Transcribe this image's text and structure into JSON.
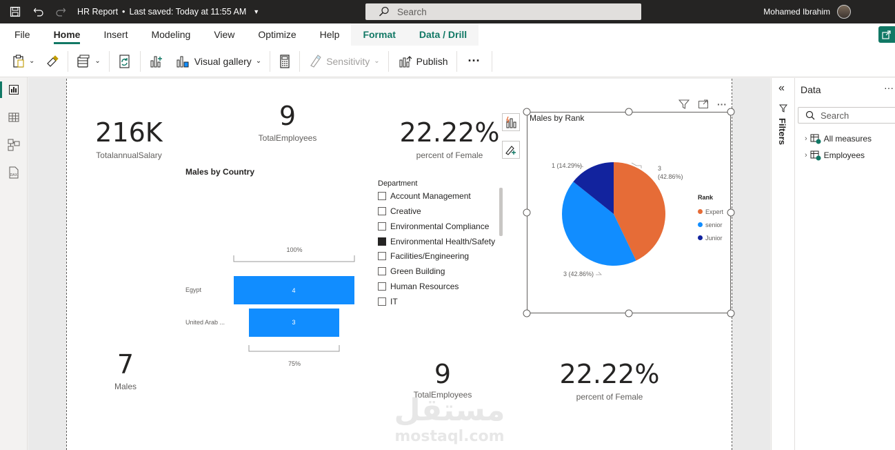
{
  "titlebar": {
    "title": "HR Report",
    "saved": "Last saved: Today at 11:55 AM",
    "search_placeholder": "Search",
    "user_name": "Mohamed Ibrahim"
  },
  "tabs": [
    {
      "label": "File"
    },
    {
      "label": "Home"
    },
    {
      "label": "Insert"
    },
    {
      "label": "Modeling"
    },
    {
      "label": "View"
    },
    {
      "label": "Optimize"
    },
    {
      "label": "Help"
    },
    {
      "label": "Format"
    },
    {
      "label": "Data / Drill"
    }
  ],
  "toolbar": {
    "visual_gallery": "Visual gallery",
    "sensitivity": "Sensitivity",
    "publish": "Publish",
    "more": "···"
  },
  "cards": {
    "salary_value": "216K",
    "salary_label": "TotalannualSalary",
    "total_value": "9",
    "total_label": "TotalEmployees",
    "female_value": "22.22%",
    "female_label": "percent of Female",
    "males_value": "7",
    "males_label": "Males",
    "total2_value": "9",
    "total2_label": "TotalEmployees",
    "female2_value": "22.22%",
    "female2_label": "percent of Female"
  },
  "funnel": {
    "title": "Males by Country",
    "top_pct": "100%",
    "bottom_pct": "75%",
    "rows": [
      {
        "label": "Egypt",
        "value": "4"
      },
      {
        "label": "United Arab ...",
        "value": "3"
      }
    ]
  },
  "slicer": {
    "title": "Department",
    "items": [
      {
        "label": "Account Management",
        "checked": false
      },
      {
        "label": "Creative",
        "checked": false
      },
      {
        "label": "Environmental Compliance",
        "checked": false
      },
      {
        "label": "Environmental Health/Safety",
        "checked": true
      },
      {
        "label": "Facilities/Engineering",
        "checked": false
      },
      {
        "label": "Green Building",
        "checked": false
      },
      {
        "label": "Human Resources",
        "checked": false
      },
      {
        "label": "IT",
        "checked": false
      }
    ]
  },
  "pie": {
    "title": "Males by Rank",
    "legend_title": "Rank",
    "labels": [
      "3",
      "(42.86%)",
      "3 (42.86%)",
      "1 (14.29%)"
    ]
  },
  "chart_data": [
    {
      "type": "bar",
      "title": "Males by Country",
      "categories": [
        "Egypt",
        "United Arab ..."
      ],
      "values": [
        4,
        3
      ]
    },
    {
      "type": "pie",
      "title": "Males by Rank",
      "categories": [
        "Expert",
        "senior",
        "Junior"
      ],
      "values": [
        3,
        3,
        1
      ],
      "percentages": [
        42.86,
        42.86,
        14.29
      ],
      "colors": [
        "#e66c37",
        "#118dff",
        "#12239e"
      ],
      "legend": "right"
    }
  ],
  "data_pane": {
    "title": "Data",
    "search_placeholder": "Search",
    "items": [
      "All measures",
      "Employees"
    ]
  },
  "filters_label": "Filters",
  "watermark": {
    "arabic": "مستقل",
    "latin": "mostaql.com"
  },
  "colors": {
    "accent": "#117865",
    "funnel_bar": "#118dff"
  }
}
